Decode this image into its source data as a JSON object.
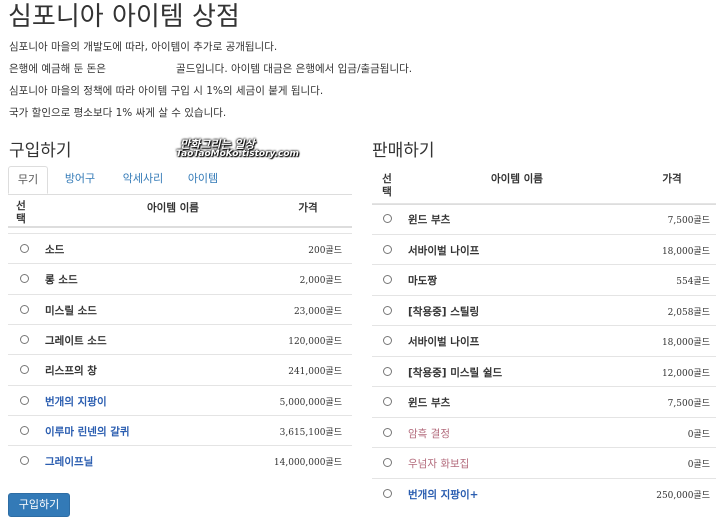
{
  "page": {
    "title": "심포니아 아이템 상점",
    "info": [
      "심포니아 마을의 개발도에 따라, 아이템이 추가로 공개됩니다.",
      "은행에 예금해 둔 돈은                     골드입니다. 아이템 대금은 은행에서 입금/출금됩니다.",
      "심포니아 마을의 정책에 따라 아이템 구입 시 1%의 세금이 붙게 됩니다.",
      "국가 할인으로 평소보다 1% 싸게 살 수 있습니다."
    ],
    "watermark": [
      "만화그리는 일상",
      "TaoTaoMoKo.tistory.com"
    ]
  },
  "buy": {
    "heading": "구입하기",
    "tabs": [
      "무기",
      "방어구",
      "악세사리",
      "아이템"
    ],
    "active_tab": "무기",
    "columns": {
      "select": "선\n택",
      "name": "아이템 이름",
      "price": "가격"
    },
    "rows": [
      {
        "name": "소드",
        "price": "200골드",
        "style": "normal"
      },
      {
        "name": "롱 소드",
        "price": "2,000골드",
        "style": "normal"
      },
      {
        "name": "미스릴 소드",
        "price": "23,000골드",
        "style": "normal"
      },
      {
        "name": "그레이트 소드",
        "price": "120,000골드",
        "style": "normal"
      },
      {
        "name": "리스프의 창",
        "price": "241,000골드",
        "style": "normal"
      },
      {
        "name": "번개의 지팡이",
        "price": "5,000,000골드",
        "style": "blue"
      },
      {
        "name": "이루마 린넨의 갈퀴",
        "price": "3,615,100골드",
        "style": "blue"
      },
      {
        "name": "그레이프닐",
        "price": "14,000,000골드",
        "style": "blue"
      }
    ],
    "submit_label": "구입하기"
  },
  "sell": {
    "heading": "판매하기",
    "columns": {
      "select": "선\n택",
      "name": "아이템 이름",
      "price": "가격"
    },
    "rows": [
      {
        "name": "윈드 부츠",
        "price": "7,500골드",
        "style": "normal"
      },
      {
        "name": "서바이벌 나이프",
        "price": "18,000골드",
        "style": "normal"
      },
      {
        "name": "마도짱",
        "price": "554골드",
        "style": "normal"
      },
      {
        "name": "[착용중] 스틸링",
        "price": "2,058골드",
        "style": "normal"
      },
      {
        "name": "서바이벌 나이프",
        "price": "18,000골드",
        "style": "normal"
      },
      {
        "name": "[착용중] 미스릴 쉴드",
        "price": "12,000골드",
        "style": "normal"
      },
      {
        "name": "윈드 부츠",
        "price": "7,500골드",
        "style": "normal"
      },
      {
        "name": "암흑 결정",
        "price": "0골드",
        "style": "pink"
      },
      {
        "name": "우넘자 화보집",
        "price": "0골드",
        "style": "pink"
      },
      {
        "name": "번개의 지팡이+",
        "price": "250,000골드",
        "style": "blue"
      }
    ]
  }
}
